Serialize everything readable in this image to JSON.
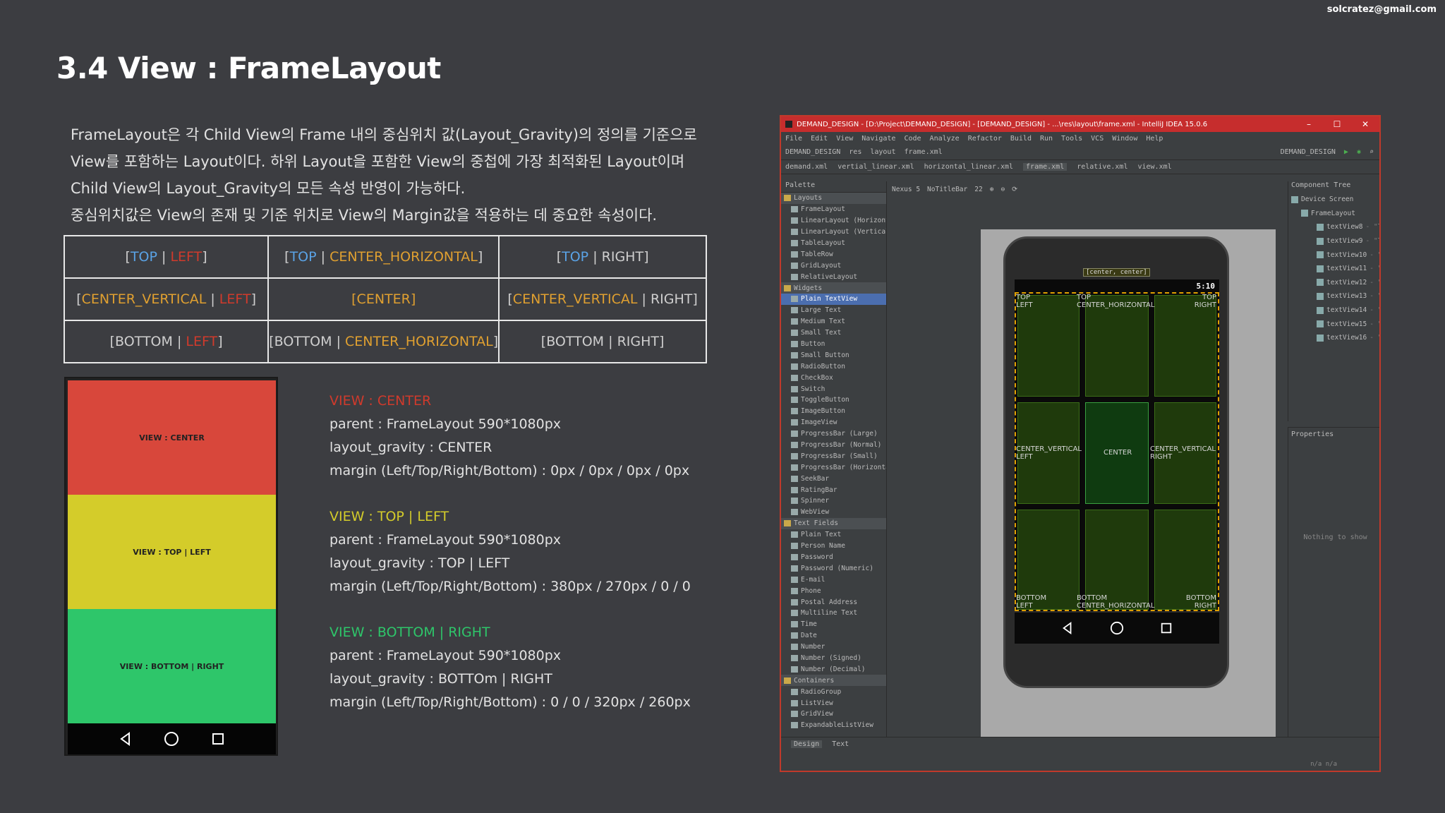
{
  "email": "solcratez@gmail.com",
  "title": "3.4 View : FrameLayout",
  "desc": [
    "FrameLayout은 각 Child View의 Frame 내의 중심위치 값(Layout_Gravity)의 정의를 기준으로",
    "View를 포함하는 Layout이다. 하위 Layout을 포함한 View의 중첩에 가장 최적화된 Layout이며",
    "Child View의 Layout_Gravity의 모든 속성 반영이 가능하다.",
    "중심위치값은 View의 존재 및 기준 위치로 View의 Margin값을 적용하는 데 중요한 속성이다."
  ],
  "gravity_table": {
    "r1": {
      "c1a": "TOP",
      "c1b": "LEFT",
      "c2a": "TOP",
      "c2b": "CENTER_HORIZONTAL",
      "c3a": "TOP",
      "c3b": "RIGHT"
    },
    "r2": {
      "c1a": "CENTER_VERTICAL",
      "c1b": "LEFT",
      "c2": "[CENTER]",
      "c3a": "CENTER_VERTICAL",
      "c3b": "RIGHT"
    },
    "r3": {
      "c1a": "BOTTOM",
      "c1b": "LEFT",
      "c2a": "BOTTOM",
      "c2b": "CENTER_HORIZONTAL",
      "c3a": "BOTTOM",
      "c3b": "RIGHT"
    }
  },
  "phone_labels": {
    "top": "VIEW : CENTER",
    "mid": "VIEW : TOP | LEFT",
    "bot": "VIEW : BOTTOM | RIGHT"
  },
  "notes": [
    {
      "h": "VIEW : CENTER",
      "color": "#d03a2c",
      "parent": "parent : FrameLayout 590*1080px",
      "gravity": "layout_gravity : CENTER",
      "margin": "margin (Left/Top/Right/Bottom) : 0px / 0px / 0px / 0px"
    },
    {
      "h": "VIEW : TOP | LEFT",
      "color": "#d4cc2a",
      "parent": "parent : FrameLayout 590*1080px",
      "gravity": "layout_gravity : TOP | LEFT",
      "margin": "margin (Left/Top/Right/Bottom) : 380px / 270px / 0 / 0"
    },
    {
      "h": "VIEW : BOTTOM | RIGHT",
      "color": "#2ec66a",
      "parent": "parent : FrameLayout 590*1080px",
      "gravity": "layout_gravity : BOTTOm | RIGHT",
      "margin": "margin (Left/Top/Right/Bottom) : 0 / 0 / 320px / 260px"
    }
  ],
  "ide": {
    "title": "DEMAND_DESIGN - [D:\\Project\\DEMAND_DESIGN] - [DEMAND_DESIGN] - ...\\res\\layout\\frame.xml - IntelliJ IDEA 15.0.6",
    "menu": [
      "File",
      "Edit",
      "View",
      "Navigate",
      "Code",
      "Analyze",
      "Refactor",
      "Build",
      "Run",
      "Tools",
      "VCS",
      "Window",
      "Help"
    ],
    "breadcrumb": [
      "DEMAND_DESIGN",
      "res",
      "layout",
      "frame.xml"
    ],
    "run_config": "DEMAND_DESIGN",
    "tabs": [
      "demand.xml",
      "vertial_linear.xml",
      "horizontal_linear.xml",
      "frame.xml",
      "relative.xml",
      "view.xml"
    ],
    "palette_title": "Palette",
    "palette": [
      {
        "t": "Layouts",
        "cat": true
      },
      {
        "t": "FrameLayout"
      },
      {
        "t": "LinearLayout (Horizont"
      },
      {
        "t": "LinearLayout (Vertical"
      },
      {
        "t": "TableLayout"
      },
      {
        "t": "TableRow"
      },
      {
        "t": "GridLayout"
      },
      {
        "t": "RelativeLayout"
      },
      {
        "t": "Widgets",
        "cat": true
      },
      {
        "t": "Plain TextView",
        "sel": true
      },
      {
        "t": "Large Text"
      },
      {
        "t": "Medium Text"
      },
      {
        "t": "Small Text"
      },
      {
        "t": "Button"
      },
      {
        "t": "Small Button"
      },
      {
        "t": "RadioButton"
      },
      {
        "t": "CheckBox"
      },
      {
        "t": "Switch"
      },
      {
        "t": "ToggleButton"
      },
      {
        "t": "ImageButton"
      },
      {
        "t": "ImageView"
      },
      {
        "t": "ProgressBar (Large)"
      },
      {
        "t": "ProgressBar (Normal)"
      },
      {
        "t": "ProgressBar (Small)"
      },
      {
        "t": "ProgressBar (Horizonta"
      },
      {
        "t": "SeekBar"
      },
      {
        "t": "RatingBar"
      },
      {
        "t": "Spinner"
      },
      {
        "t": "WebView"
      },
      {
        "t": "Text Fields",
        "cat": true
      },
      {
        "t": "Plain Text"
      },
      {
        "t": "Person Name"
      },
      {
        "t": "Password"
      },
      {
        "t": "Password (Numeric)"
      },
      {
        "t": "E-mail"
      },
      {
        "t": "Phone"
      },
      {
        "t": "Postal Address"
      },
      {
        "t": "Multiline Text"
      },
      {
        "t": "Time"
      },
      {
        "t": "Date"
      },
      {
        "t": "Number"
      },
      {
        "t": "Number (Signed)"
      },
      {
        "t": "Number (Decimal)"
      },
      {
        "t": "Containers",
        "cat": true
      },
      {
        "t": "RadioGroup"
      },
      {
        "t": "ListView"
      },
      {
        "t": "GridView"
      },
      {
        "t": "ExpandableListView"
      }
    ],
    "canvas_tools": [
      "Nexus 5",
      "NoTitleBar",
      "22"
    ],
    "canvas_label": "[center, center]",
    "clock": "5:10",
    "cells": {
      "tl": "TOP\nLEFT",
      "tc": "TOP\nCENTER_HORIZONTAL",
      "tr": "TOP\nRIGHT",
      "ml": "CENTER_VERTICAL\nLEFT",
      "mc": "CENTER",
      "mr": "CENTER_VERTICAL\nRIGHT",
      "bl": "BOTTOM\nLEFT",
      "bc": "BOTTOM\nCENTER_HORIZONTAL",
      "br": "BOTTOM\nRIGHT"
    },
    "tree_title": "Component Tree",
    "tree": [
      {
        "n": "Device Screen",
        "v": ""
      },
      {
        "n": "FrameLayout",
        "v": ""
      },
      {
        "n": "textView8",
        "v": "- \"TOP\\nLEFT\""
      },
      {
        "n": "textView9",
        "v": "- \"TOP\\nCENTER_HORIZONTAL\""
      },
      {
        "n": "textView10",
        "v": "- \"TOP\\nRIGHT\""
      },
      {
        "n": "textView11",
        "v": "- \"CENTER_VERTICAL\\nRIGHT\""
      },
      {
        "n": "textView12",
        "v": "- \"CENTER\""
      },
      {
        "n": "textView13",
        "v": "- \"CENTER_VERTICAL\\nLEFT\""
      },
      {
        "n": "textView14",
        "v": "- \"BOTTOM\\nLEFT\""
      },
      {
        "n": "textView15",
        "v": "- \"BOTTOM\\nCENTER_HORIZONTAL\""
      },
      {
        "n": "textView16",
        "v": "- \"BOTTOM\\nRIGHT\""
      }
    ],
    "props_title": "Properties",
    "props_empty": "Nothing to show",
    "bottom_tabs": [
      "Design",
      "Text"
    ],
    "status": "n/a    n/a"
  }
}
